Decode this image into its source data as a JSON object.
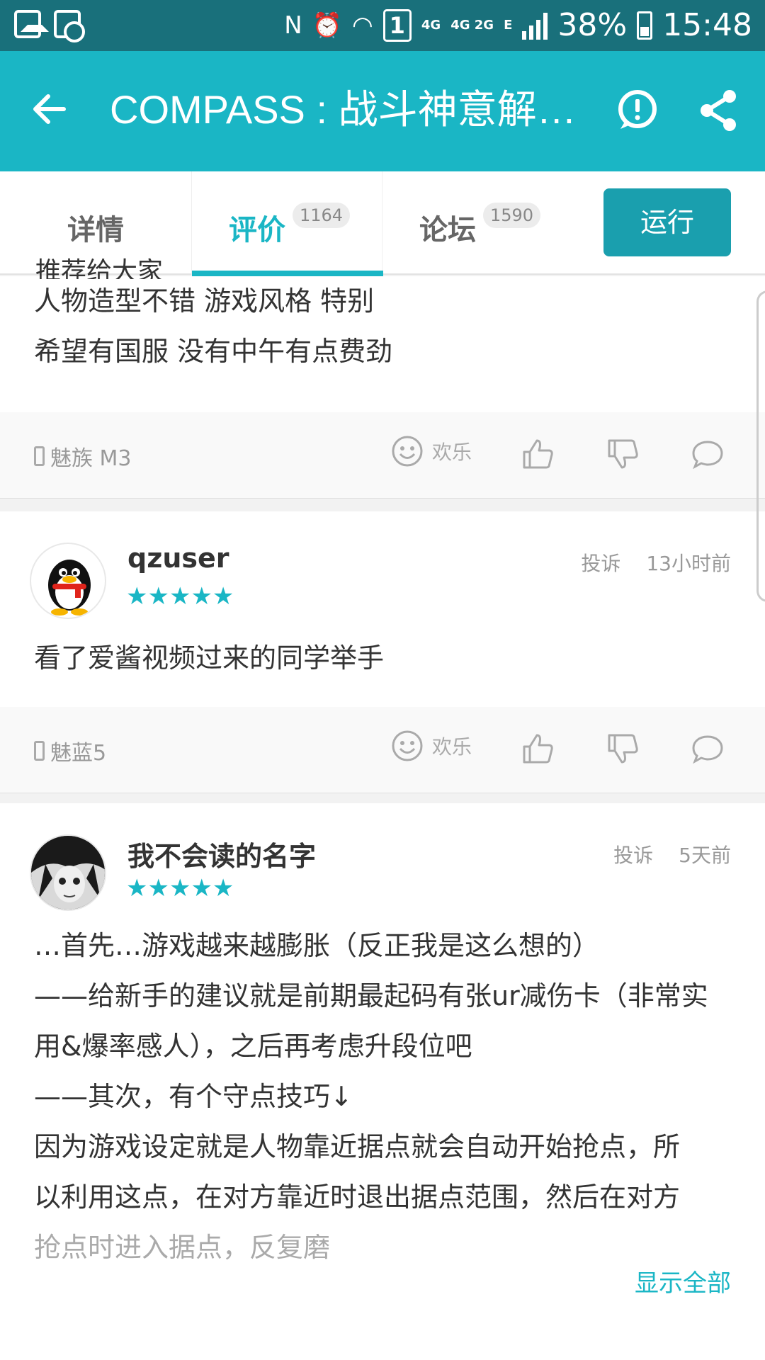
{
  "status_bar": {
    "net1": "4G",
    "net2": "4G 2G",
    "sim": "1",
    "edge": "E",
    "battery": "38%",
    "time": "15:48"
  },
  "app_bar": {
    "title": "COMPASS : 战斗神意解…"
  },
  "tabs": [
    {
      "label": "详情"
    },
    {
      "label": "评价",
      "count": "1164",
      "active": true
    },
    {
      "label": "论坛",
      "count": "1590"
    }
  ],
  "run_button": "运行",
  "reviews": [
    {
      "partial_line": "推荐给大家",
      "lines": [
        "人物造型不错 游戏风格 特别",
        "希望有国服 没有中午有点费劲"
      ],
      "device": "魅族 M3",
      "emotion": "欢乐"
    },
    {
      "username": "qzuser",
      "stars": "★★★★★",
      "report": "投诉",
      "time": "13小时前",
      "lines": [
        "看了爱酱视频过来的同学举手"
      ],
      "device": "魅蓝5",
      "emotion": "欢乐"
    },
    {
      "username": "我不会读的名字",
      "stars": "★★★★★",
      "report": "投诉",
      "time": "5天前",
      "lines": [
        "…首先…游戏越来越膨胀（反正我是这么想的）",
        "——给新手的建议就是前期最起码有张ur减伤卡（非常实",
        "用&爆率感人），之后再考虑升段位吧",
        "——其次，有个守点技巧↓",
        "因为游戏设定就是人物靠近据点就会自动开始抢点，所",
        "以利用这点，在对方靠近时退出据点范围，然后在对方",
        "抢点时进入据点，反复磨"
      ],
      "show_all": "显示全部"
    }
  ],
  "colors": {
    "accent": "#1ab6c5",
    "status_bar": "#19707b",
    "run_button": "#1a9fae"
  }
}
